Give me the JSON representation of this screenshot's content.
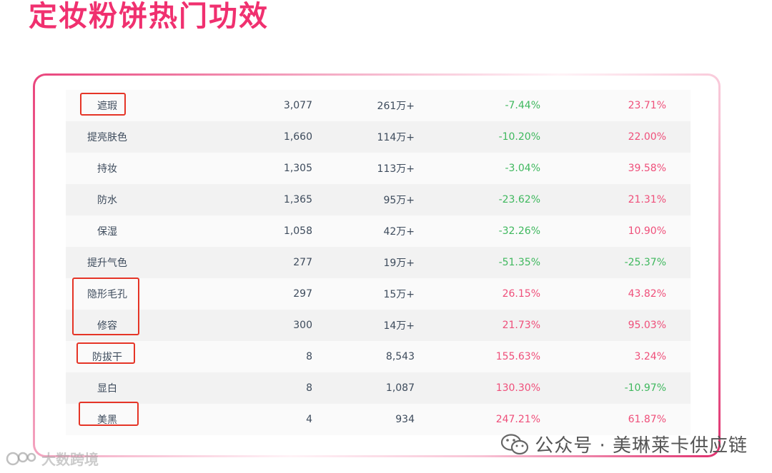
{
  "title": "定妆粉饼热门功效",
  "rows": [
    {
      "name": "遮瑕",
      "n1": "3,077",
      "n2": "261万+",
      "p1": "-7.44%",
      "p2": "23.71%"
    },
    {
      "name": "提亮肤色",
      "n1": "1,660",
      "n2": "114万+",
      "p1": "-10.20%",
      "p2": "22.00%"
    },
    {
      "name": "持妆",
      "n1": "1,305",
      "n2": "113万+",
      "p1": "-3.04%",
      "p2": "39.58%"
    },
    {
      "name": "防水",
      "n1": "1,365",
      "n2": "95万+",
      "p1": "-23.62%",
      "p2": "21.31%"
    },
    {
      "name": "保湿",
      "n1": "1,058",
      "n2": "42万+",
      "p1": "-32.26%",
      "p2": "10.90%"
    },
    {
      "name": "提升气色",
      "n1": "277",
      "n2": "19万+",
      "p1": "-51.35%",
      "p2": "-25.37%"
    },
    {
      "name": "隐形毛孔",
      "n1": "297",
      "n2": "15万+",
      "p1": "26.15%",
      "p2": "43.82%"
    },
    {
      "name": "修容",
      "n1": "300",
      "n2": "14万+",
      "p1": "21.73%",
      "p2": "95.03%"
    },
    {
      "name": "防拔干",
      "n1": "8",
      "n2": "8,543",
      "p1": "155.63%",
      "p2": "3.24%"
    },
    {
      "name": "显白",
      "n1": "8",
      "n2": "1,087",
      "p1": "130.30%",
      "p2": "-10.97%"
    },
    {
      "name": "美黑",
      "n1": "4",
      "n2": "934",
      "p1": "247.21%",
      "p2": "61.87%"
    }
  ],
  "colors": {
    "positive": "#ef4f7a",
    "negative": "#3fb85e",
    "highlight_box": "#e53426",
    "title": "#f0306f"
  },
  "watermark": {
    "text": "公众号 · 美琳莱卡供应链",
    "icon": "wechat-icon"
  },
  "brand": {
    "text": "大数跨境",
    "icon": "brand-logo-icon"
  }
}
